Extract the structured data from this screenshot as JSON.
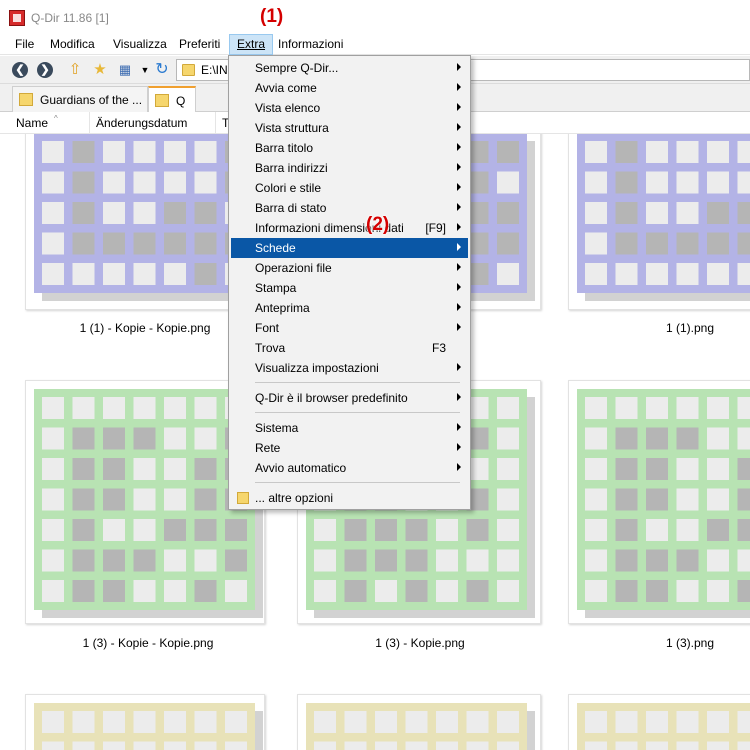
{
  "window": {
    "title": "Q-Dir 11.86 [1]"
  },
  "annotations": {
    "a1": "(1)",
    "a2": "(2)"
  },
  "menubar": {
    "items": [
      "File",
      "Modifica",
      "Visualizza",
      "Preferiti",
      "Extra",
      "Informazioni"
    ],
    "active": "Extra"
  },
  "toolbar": {
    "icons": [
      "back-icon",
      "forward-icon",
      "up-folder-icon",
      "new-folder-icon",
      "view-mode-icon",
      "dropdown-arrow-icon",
      "refresh-icon"
    ],
    "address_value": "E:\\INE"
  },
  "tabs": [
    {
      "label": "Guardians of the ..."
    },
    {
      "label": "Q"
    }
  ],
  "columns": [
    "Name",
    "Änderungsdatum",
    "Ty"
  ],
  "files": {
    "r1": [
      "1 (1) - Kopie - Kopie.png",
      "",
      "1 (1).png"
    ],
    "r2": [
      "1 (3) - Kopie - Kopie.png",
      "1 (3) - Kopie.png",
      "1 (3).png"
    ]
  },
  "thumb_colors": {
    "row1": "#b3b3e6",
    "row2": "#b8e3b3",
    "row3": "#e8e2b8",
    "cell_light": "#ececec",
    "cell_dark": "#b5b5b5"
  },
  "dropdown": {
    "items": [
      {
        "label": "Sempre Q-Dir...",
        "submenu": true
      },
      {
        "label": "Avvia come",
        "submenu": true
      },
      {
        "label": "Vista elenco",
        "submenu": true
      },
      {
        "label": "Vista struttura",
        "submenu": true
      },
      {
        "label": "Barra titolo",
        "submenu": true
      },
      {
        "label": "Barra indirizzi",
        "submenu": true
      },
      {
        "label": "Colori e stile",
        "submenu": true
      },
      {
        "label": "Barra di stato",
        "submenu": true
      },
      {
        "label": "Informazioni dimensioni dati",
        "shortcut": "[F9]",
        "submenu": true
      },
      {
        "label": "Schede",
        "submenu": true,
        "highlighted": true
      },
      {
        "label": "Operazioni file",
        "submenu": true
      },
      {
        "label": "Stampa",
        "submenu": true
      },
      {
        "label": "Anteprima",
        "submenu": true
      },
      {
        "label": "Font",
        "submenu": true
      },
      {
        "label": "Trova",
        "shortcut": "F3"
      },
      {
        "label": "Visualizza impostazioni",
        "submenu": true
      },
      {
        "label": "Q-Dir è il browser predefinito",
        "submenu": true
      },
      {
        "label": "Sistema",
        "submenu": true
      },
      {
        "label": "Rete",
        "submenu": true
      },
      {
        "label": "Avvio automatico",
        "submenu": true
      },
      {
        "label": "... altre opzioni"
      }
    ]
  }
}
